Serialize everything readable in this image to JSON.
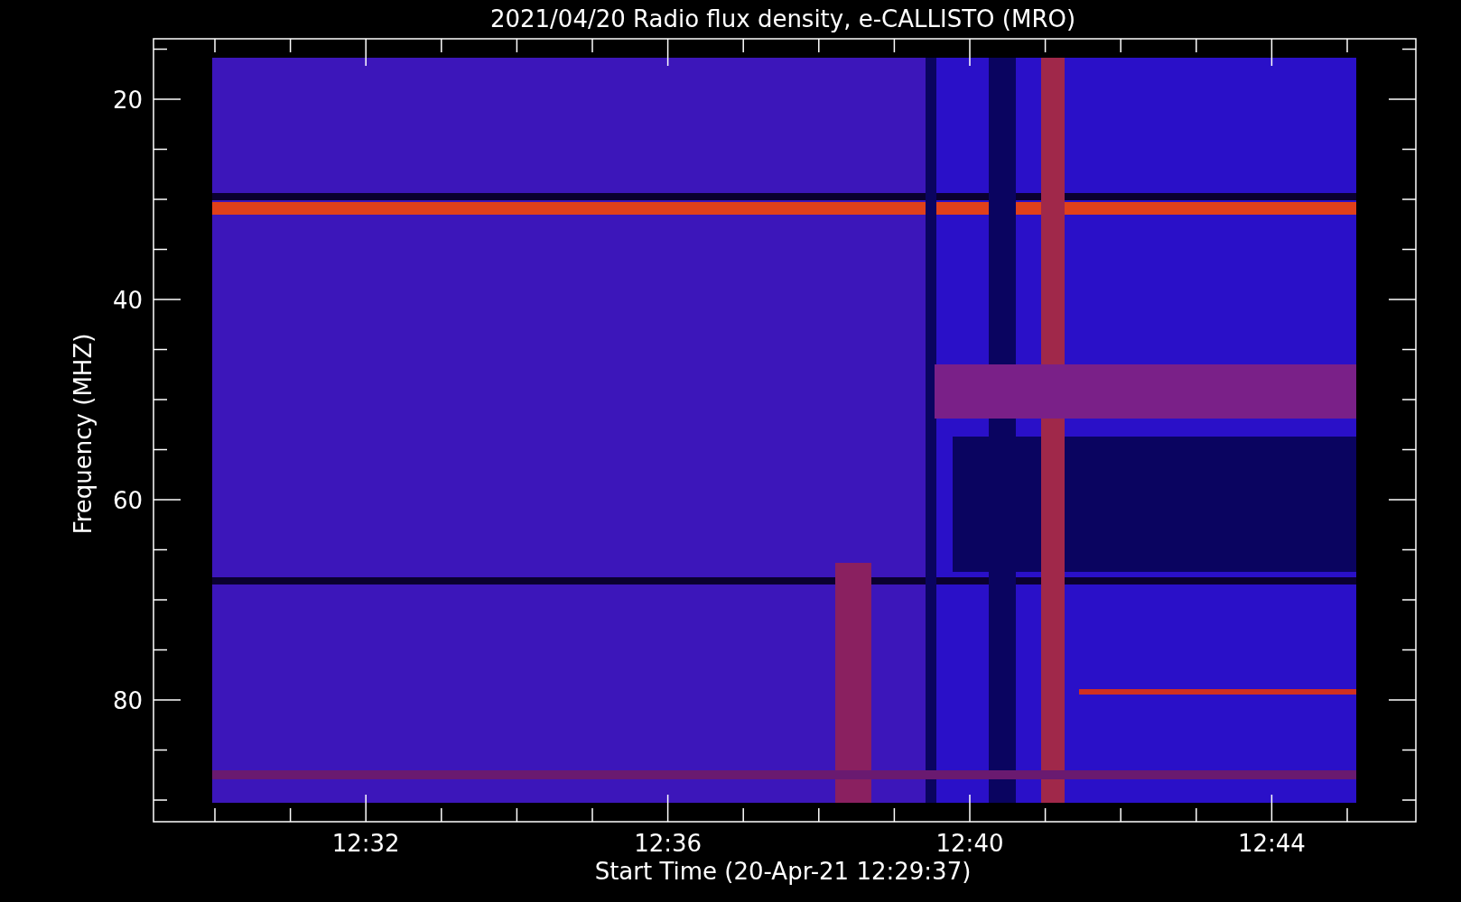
{
  "title": "2021/04/20  Radio flux density, e-CALLISTO (MRO)",
  "y_axis": {
    "label": "Frequency (MHZ)",
    "ticks": [
      "20",
      "40",
      "60",
      "80"
    ]
  },
  "x_axis": {
    "label": "Start Time (20-Apr-21 12:29:37)",
    "ticks": [
      "12:32",
      "12:36",
      "12:40",
      "12:44"
    ]
  }
}
